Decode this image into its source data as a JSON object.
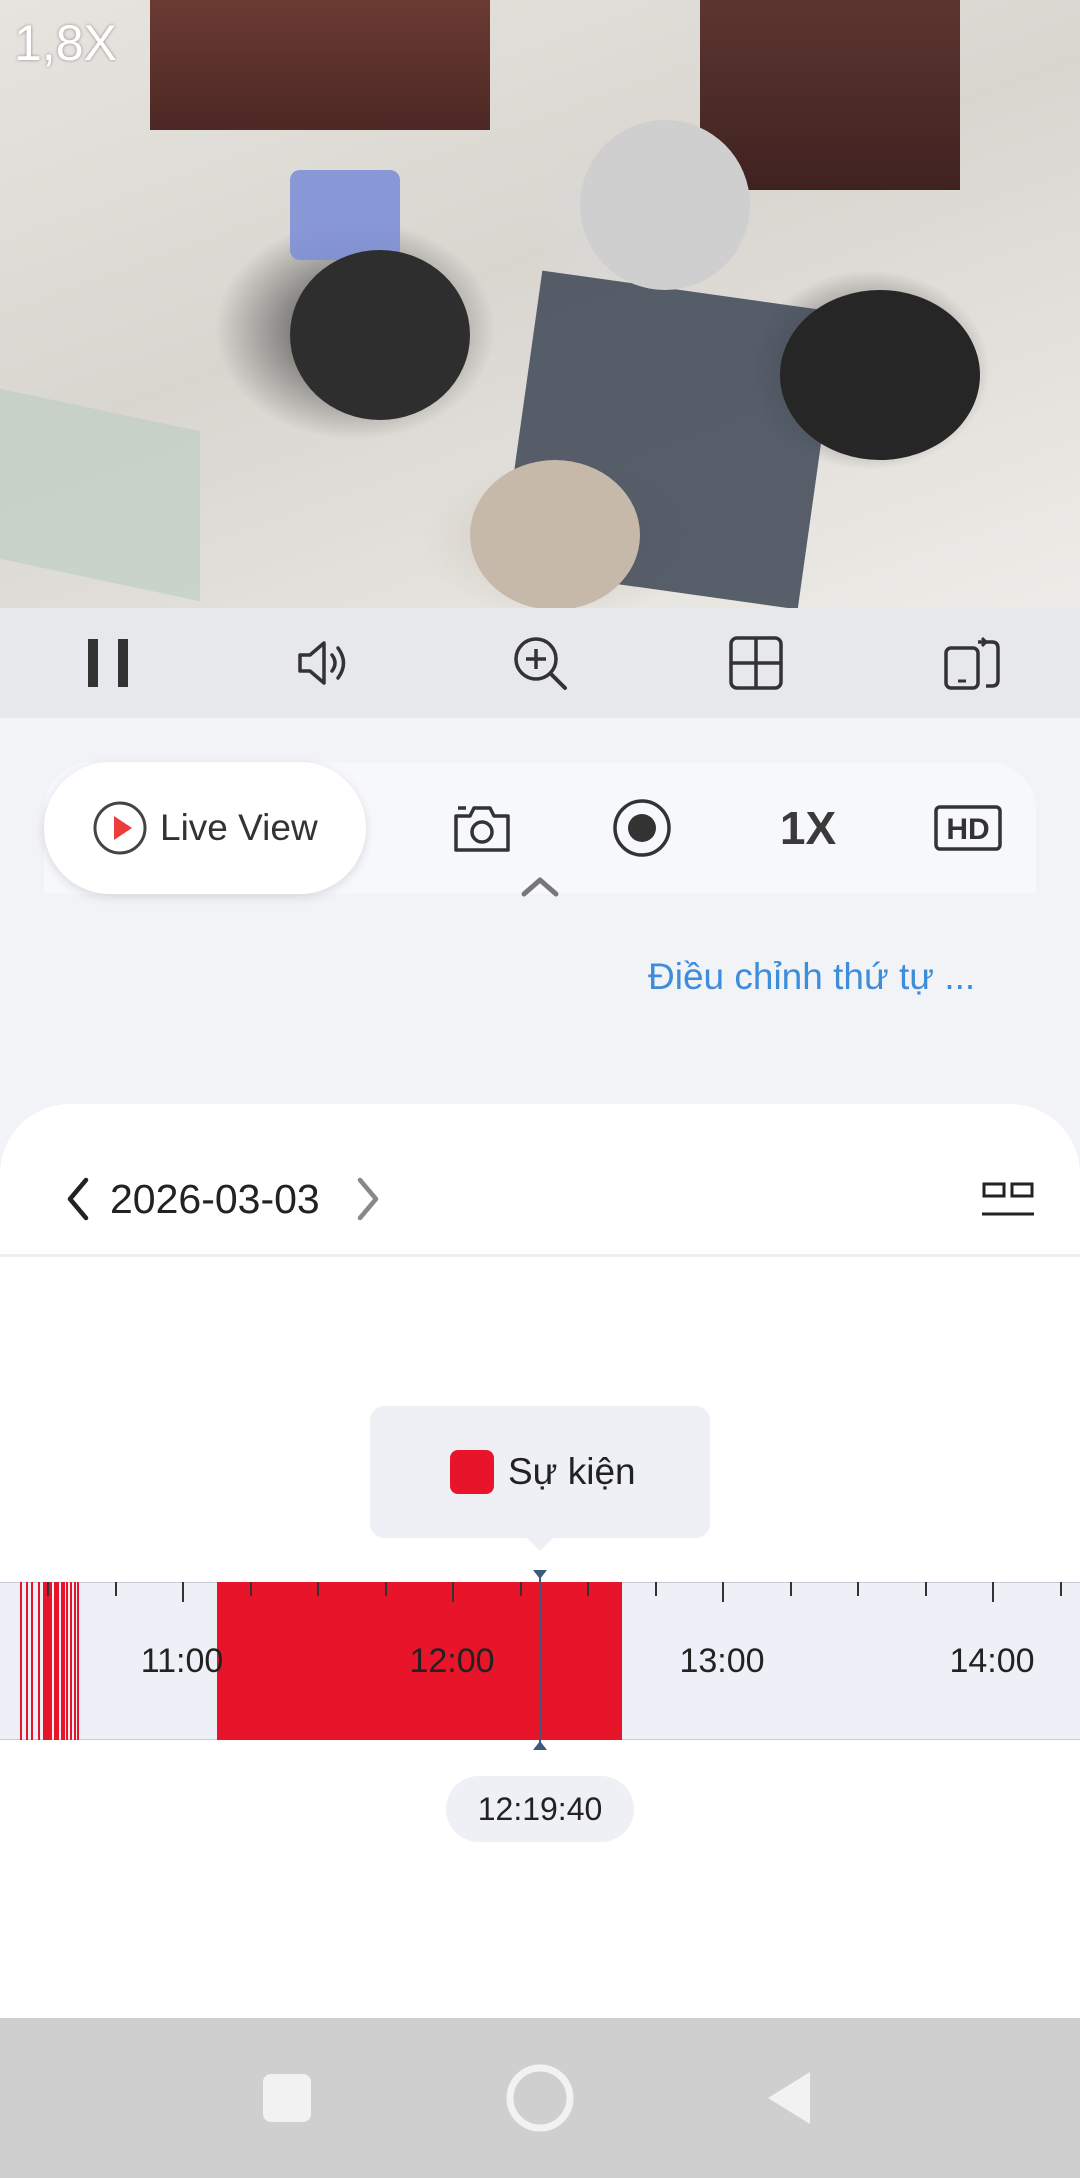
{
  "video": {
    "zoom_level": "1,8X"
  },
  "toolbar": {
    "buttons": [
      "pause-icon",
      "volume-icon",
      "zoom-in-icon",
      "grid-icon",
      "rotate-screen-icon"
    ]
  },
  "actions": {
    "live_view_label": "Live View",
    "speed_label": "1X",
    "quality_label": "HD",
    "adjust_order_label": "Điều chỉnh thứ tự ..."
  },
  "playback": {
    "date": "2026-03-03",
    "legend_label": "Sự kiện",
    "event_color": "#e8142a",
    "current_time": "12:19:40",
    "hour_labels": [
      "11:00",
      "12:00",
      "13:00",
      "14:00"
    ]
  },
  "navbar": {
    "buttons": [
      "recent-apps-icon",
      "home-icon",
      "back-icon"
    ]
  }
}
